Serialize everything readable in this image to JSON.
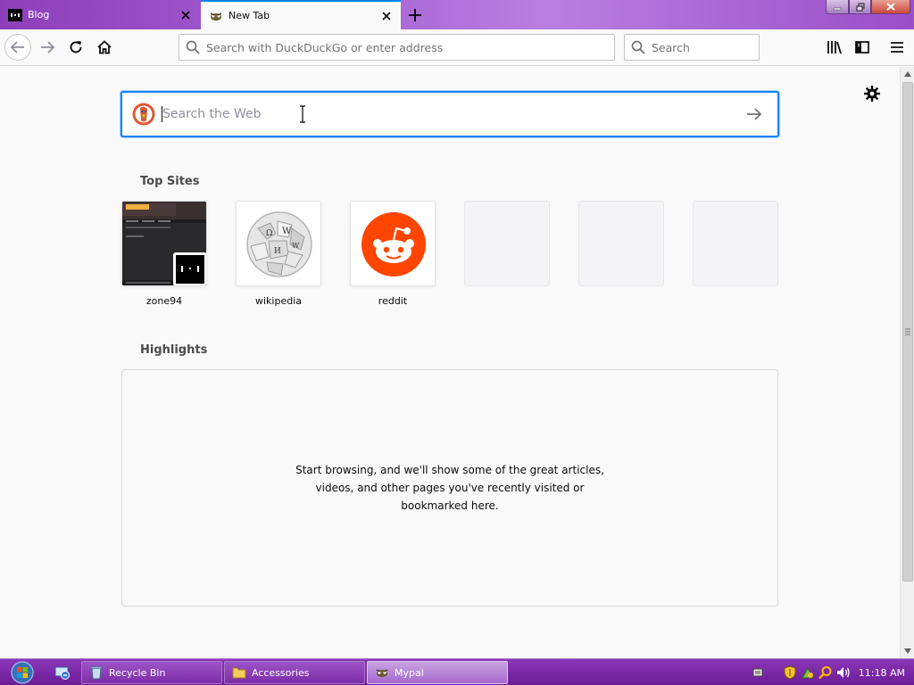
{
  "tabs": [
    {
      "title": "Blog",
      "active": false
    },
    {
      "title": "New Tab",
      "active": true
    }
  ],
  "navbar": {
    "url_placeholder": "Search with DuckDuckGo or enter address",
    "search_placeholder": "Search"
  },
  "newtab": {
    "search_placeholder": "Search the Web",
    "top_sites_title": "Top Sites",
    "top_sites": [
      {
        "label": "zone94"
      },
      {
        "label": "wikipedia"
      },
      {
        "label": "reddit"
      },
      {
        "label": ""
      },
      {
        "label": ""
      },
      {
        "label": ""
      }
    ],
    "highlights_title": "Highlights",
    "highlights_message": "Start browsing, and we'll show some of the great articles, videos, and other pages you've recently visited or bookmarked here."
  },
  "taskbar": {
    "tasks": [
      {
        "label": "Recycle Bin",
        "icon": "recycle-bin-icon",
        "active": false
      },
      {
        "label": "Accessories",
        "icon": "folder-icon",
        "active": false
      },
      {
        "label": "Mypal",
        "icon": "mypal-icon",
        "active": true
      }
    ],
    "clock": "11:18 AM"
  },
  "colors": {
    "accent": "#0a84ff",
    "tabstrip": "#a45fd3",
    "reddit": "#ff4500",
    "taskbar": "#7b2aa6"
  }
}
